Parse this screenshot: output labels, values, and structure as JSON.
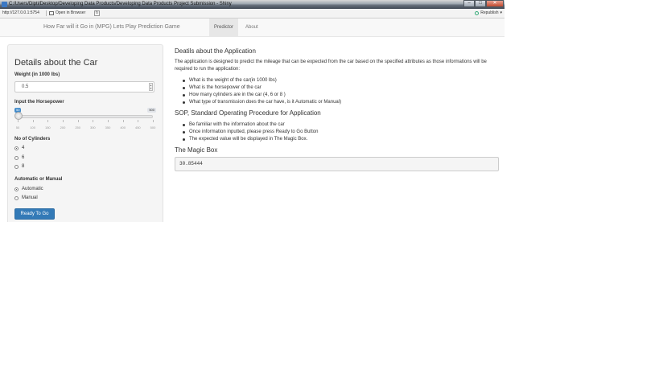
{
  "window": {
    "title": "C:/Users/Dipti/Desktop/Developing Data Products/Developing Data Products Project Submission - Shiny",
    "url": "http://127.0.0.1:5754",
    "open_in_browser": "Open in Browser",
    "publish": "Republish"
  },
  "nav": {
    "brand": "How Far will it Go in (MPG) Lets Play Prediction Game",
    "tabs": [
      {
        "label": "Predictor",
        "active": true
      },
      {
        "label": "About",
        "active": false
      }
    ]
  },
  "sidebar": {
    "title": "Details about the Car",
    "weight": {
      "label": "Weight (in 1000 lbs)",
      "value": "0.5"
    },
    "horsepower": {
      "label": "Input the Horsepower",
      "value": "50",
      "min": 50,
      "max": 500,
      "max_label": "500",
      "ticks": [
        "50",
        "100",
        "150",
        "200",
        "250",
        "300",
        "350",
        "400",
        "450",
        "500"
      ]
    },
    "cylinders": {
      "label": "No of Cylinders",
      "options": [
        "4",
        "6",
        "8"
      ],
      "selected": "4"
    },
    "transmission": {
      "label": "Automatic or Manual",
      "options": [
        "Automatic",
        "Manual"
      ],
      "selected": "Automatic"
    },
    "submit_label": "Ready To Go"
  },
  "main": {
    "app_heading": "Deatils about the Application",
    "app_desc": "The application is designed to predict the mileage that can be expected from the car based on the specified attributes as those informations will be required to run the application:",
    "app_items": [
      "What is the weight of the car(in 1000 lbs)",
      "What is the horsepower of the car",
      "How many cylinders are in the car (4, 6 or 8 )",
      "What type of transmission does the car have, is it Automatic or Manual)"
    ],
    "sop_heading": "SOP, Standard Operating Procedure for Application",
    "sop_items": [
      "Be familiar with the information about the car",
      "Once information inputted, please press Ready to Go Button",
      "The expected value will be displayed in The Magic Box."
    ],
    "magic_heading": "The Magic Box",
    "magic_value": "30.85444"
  }
}
